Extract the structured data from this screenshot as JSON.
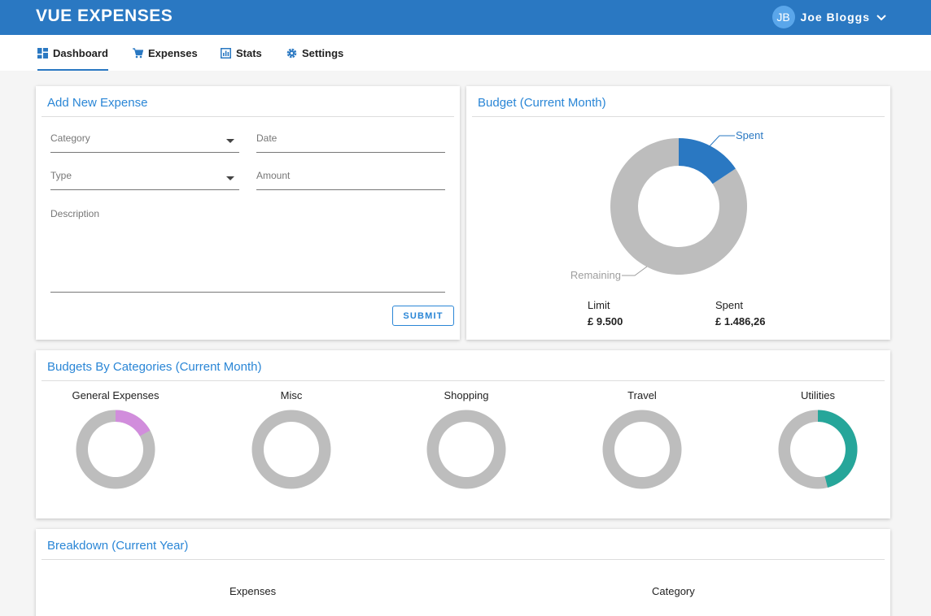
{
  "app": {
    "title": "VUE EXPENSES"
  },
  "user": {
    "initials": "JB",
    "name": "Joe Bloggs"
  },
  "tabs": [
    {
      "label": "Dashboard",
      "icon": "dashboard-icon",
      "active": true
    },
    {
      "label": "Expenses",
      "icon": "cart-icon",
      "active": false
    },
    {
      "label": "Stats",
      "icon": "chart-icon",
      "active": false
    },
    {
      "label": "Settings",
      "icon": "gear-icon",
      "active": false
    }
  ],
  "add_expense": {
    "title": "Add New Expense",
    "category_label": "Category",
    "date_label": "Date",
    "type_label": "Type",
    "amount_label": "Amount",
    "description_label": "Description",
    "submit_label": "SUBMIT"
  },
  "budget": {
    "title": "Budget (Current Month)",
    "spent_label": "Spent",
    "remaining_label": "Remaining",
    "limit_label": "Limit",
    "limit_value": "£ 9.500",
    "spent_stat_label": "Spent",
    "spent_value": "£ 1.486,26",
    "spent_fraction": 0.1565,
    "colors": {
      "spent": "#2a78c2",
      "remaining": "#bdbdbd"
    }
  },
  "categories_card": {
    "title": "Budgets By Categories (Current Month)",
    "items": [
      {
        "name": "General Expenses",
        "fraction": 0.17,
        "color": "#d18ddc"
      },
      {
        "name": "Misc",
        "fraction": 0,
        "color": "#bdbdbd"
      },
      {
        "name": "Shopping",
        "fraction": 0,
        "color": "#bdbdbd"
      },
      {
        "name": "Travel",
        "fraction": 0,
        "color": "#bdbdbd"
      },
      {
        "name": "Utilities",
        "fraction": 0.46,
        "color": "#26a69a"
      }
    ]
  },
  "breakdown": {
    "title": "Breakdown (Current Year)",
    "columns": [
      "Expenses",
      "Category"
    ]
  },
  "chart_data": {
    "type": "pie",
    "categories": [
      "Spent",
      "Remaining"
    ],
    "values": [
      1486.26,
      8013.74
    ]
  }
}
